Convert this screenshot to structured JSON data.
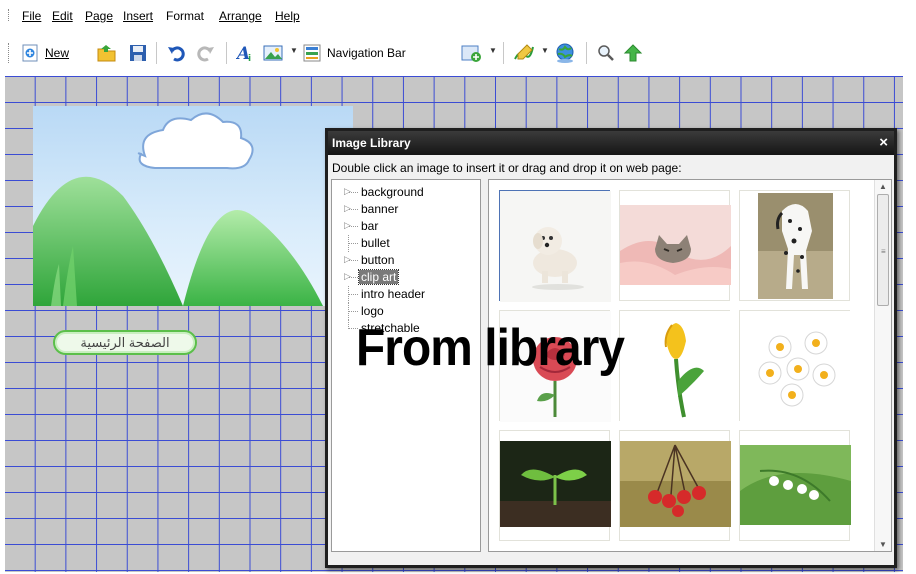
{
  "menu": {
    "items": [
      {
        "label": "File"
      },
      {
        "label": "Edit"
      },
      {
        "label": "Page"
      },
      {
        "label": "Insert"
      },
      {
        "label": "Format"
      },
      {
        "label": "Arrange"
      },
      {
        "label": "Help"
      }
    ]
  },
  "toolbar": {
    "new_label": "New",
    "navbar_label": "Navigation Bar"
  },
  "canvas": {
    "nav_button_label": "الصفحة الرئيسية"
  },
  "dialog": {
    "title": "Image Library",
    "close": "×",
    "instruction": "Double click an image to insert it or drag and drop it on web page:",
    "categories": [
      {
        "label": "background",
        "expandable": true
      },
      {
        "label": "banner",
        "expandable": true
      },
      {
        "label": "bar",
        "expandable": true
      },
      {
        "label": "bullet",
        "expandable": false
      },
      {
        "label": "button",
        "expandable": true
      },
      {
        "label": "clip art",
        "expandable": true,
        "selected": true
      },
      {
        "label": "intro header",
        "expandable": false
      },
      {
        "label": "logo",
        "expandable": false
      },
      {
        "label": "stretchable",
        "expandable": false
      }
    ],
    "thumbnails": [
      {
        "subject": "white puppy",
        "selected": true
      },
      {
        "subject": "kitten in pink blanket"
      },
      {
        "subject": "dalmatian dog"
      },
      {
        "subject": "red rose"
      },
      {
        "subject": "yellow tulip"
      },
      {
        "subject": "daisies"
      },
      {
        "subject": "green sprout"
      },
      {
        "subject": "red berries"
      },
      {
        "subject": "lily of the valley"
      }
    ]
  },
  "overlay_caption": "From library",
  "colors": {
    "grid": "#2c3fd6",
    "dialog_title_bg": "#1f1f1f",
    "toolbar_accent": "#2a7bd6"
  }
}
